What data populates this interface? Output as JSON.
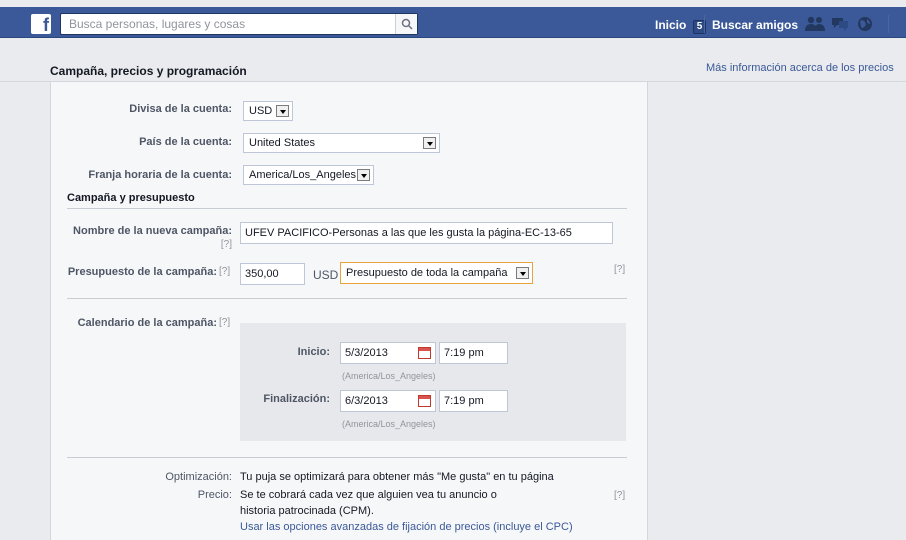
{
  "topbar": {
    "logo": "f",
    "search_placeholder": "Busca personas, lugares y cosas",
    "home_label": "Inicio",
    "home_count": "5",
    "find_friends": "Buscar amigos"
  },
  "header": {
    "title": "Campaña, precios y programación",
    "more_info_link": "Más información acerca de los precios"
  },
  "form": {
    "currency_label": "Divisa de la cuenta:",
    "currency_value": "USD",
    "country_label": "País de la cuenta:",
    "country_value": "United States",
    "timezone_label": "Franja horaria de la cuenta:",
    "timezone_value": "America/Los_Angeles",
    "section_title": "Campaña y presupuesto",
    "campaign_name_label": "Nombre de la nueva campaña:",
    "help": "[?]",
    "campaign_name_value": "UFEV PACIFICO-Personas a las que les gusta la página-EC-13-65",
    "budget_label": "Presupuesto de la campaña:",
    "budget_value": "350,00",
    "budget_currency": "USD",
    "budget_type": "Presupuesto de toda la campaña",
    "schedule_label": "Calendario de la campaña:",
    "start_label": "Inicio:",
    "start_date": "5/3/2013",
    "start_time": "7:19 pm",
    "start_tz": "(America/Los_Angeles)",
    "end_label": "Finalización:",
    "end_date": "6/3/2013",
    "end_time": "7:19 pm",
    "end_tz": "(America/Los_Angeles)",
    "optimization_label": "Optimización:",
    "optimization_text": "Tu puja se optimizará para obtener más \"Me gusta\" en tu página",
    "price_label": "Precio:",
    "price_text_1": "Se te cobrará cada vez que alguien vea tu anuncio o",
    "price_text_2": "historia patrocinada (CPM).",
    "advanced_link": "Usar las opciones avanzadas de fijación de precios (incluye el CPC)"
  }
}
